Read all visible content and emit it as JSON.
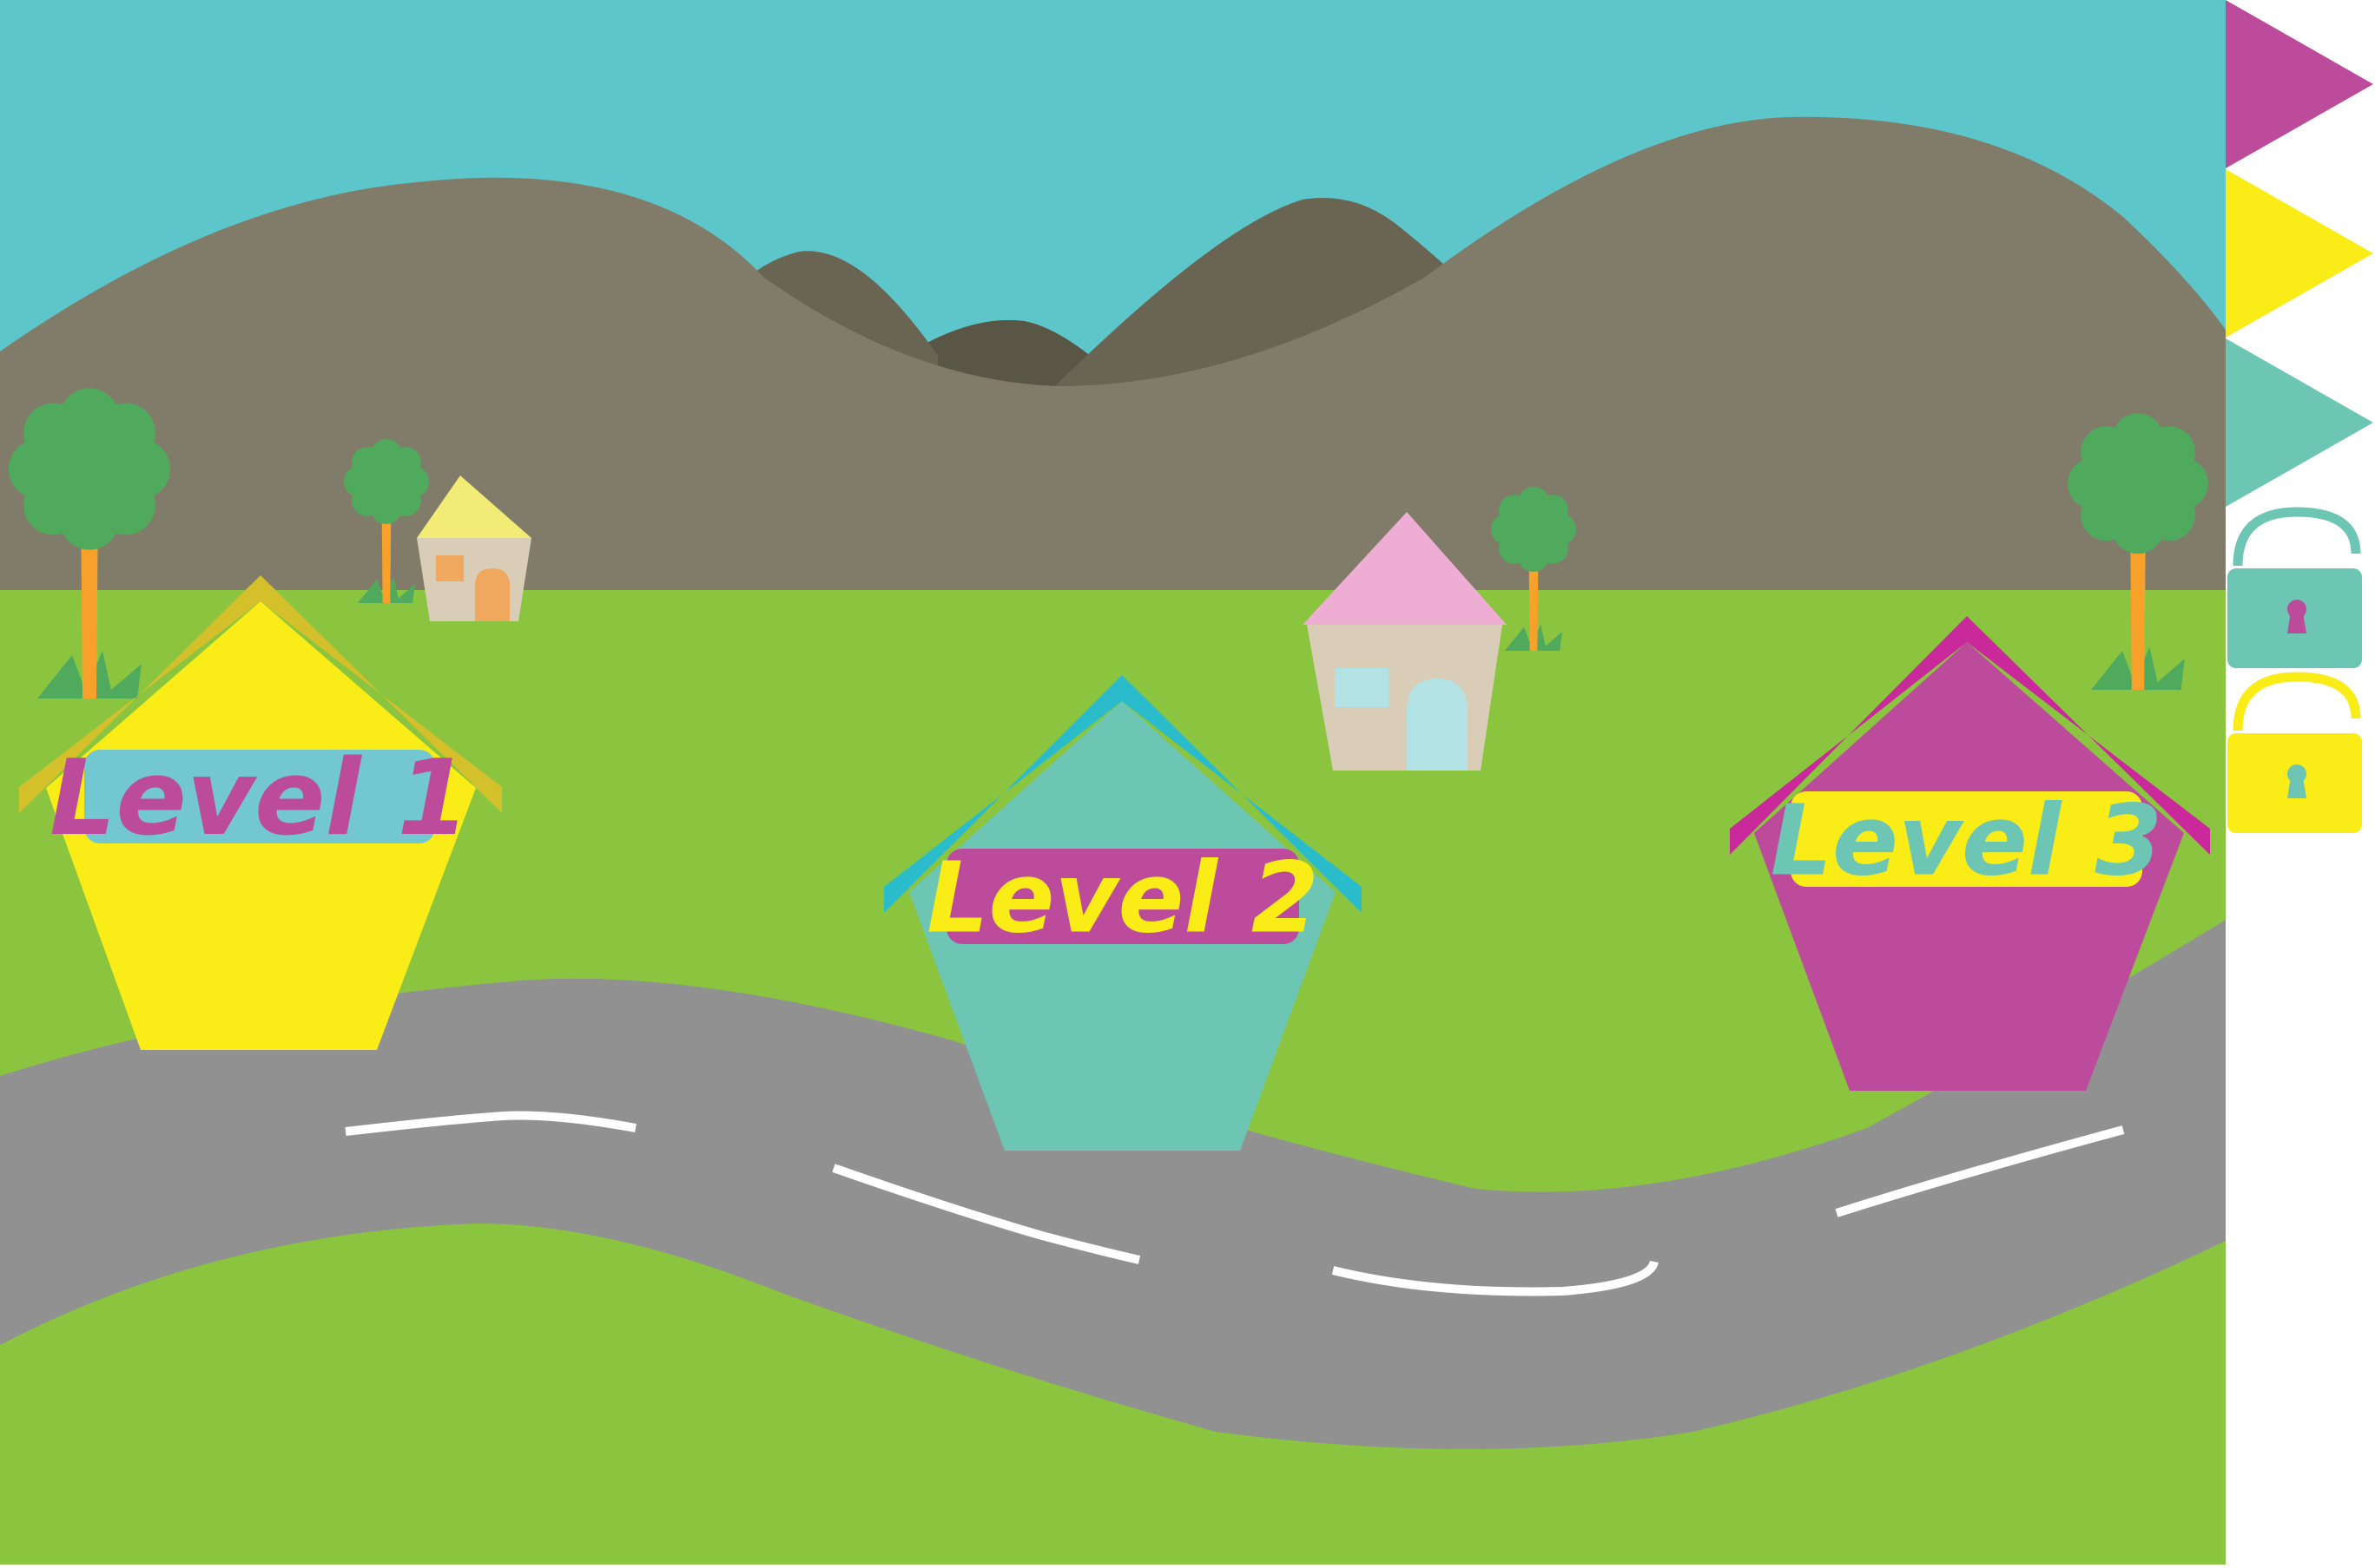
{
  "levels": [
    {
      "label": "Level 1",
      "state": "unlocked",
      "roof_color": "#D4C02A",
      "house_color": "#F9EC17",
      "sign_color": "#72C7D1",
      "text_color": "#BC4C9B"
    },
    {
      "label": "Level 2",
      "state": "locked",
      "roof_color": "#2ABCCA",
      "house_color": "#6CC6B3",
      "sign_color": "#BC4C9B",
      "text_color": "#F9EC17"
    },
    {
      "label": "Level 3",
      "state": "locked",
      "roof_color": "#C9299A",
      "house_color": "#BC4C9B",
      "sign_color": "#F9EC17",
      "text_color": "#6CC6B3"
    }
  ],
  "sidebar": {
    "flags": [
      {
        "name": "magenta-flag",
        "color": "#BC4C9B"
      },
      {
        "name": "yellow-flag",
        "color": "#F9EC17"
      },
      {
        "name": "teal-flag",
        "color": "#6CC6B3"
      }
    ],
    "locks": [
      {
        "name": "teal-lock",
        "color": "#6CC6B3",
        "keyhole_color": "#BC4C9B"
      },
      {
        "name": "yellow-lock",
        "color": "#F9EC17",
        "keyhole_color": "#6CC6B3"
      }
    ]
  },
  "colors": {
    "sky": "#5DC6CA",
    "hills": "#817C69",
    "far_mountains": "#6A6553",
    "farthest_mountains": "#5A5646",
    "grass": "#8BC53F",
    "road": "#919191",
    "road_markings": "#FFFFFF",
    "tree_foliage": "#50AA5E",
    "tree_trunk": "#F7A02A",
    "tuft": "#50AA5E"
  },
  "icons": [
    "tree-icon",
    "house-icon",
    "lock-icon",
    "flag-icon"
  ]
}
